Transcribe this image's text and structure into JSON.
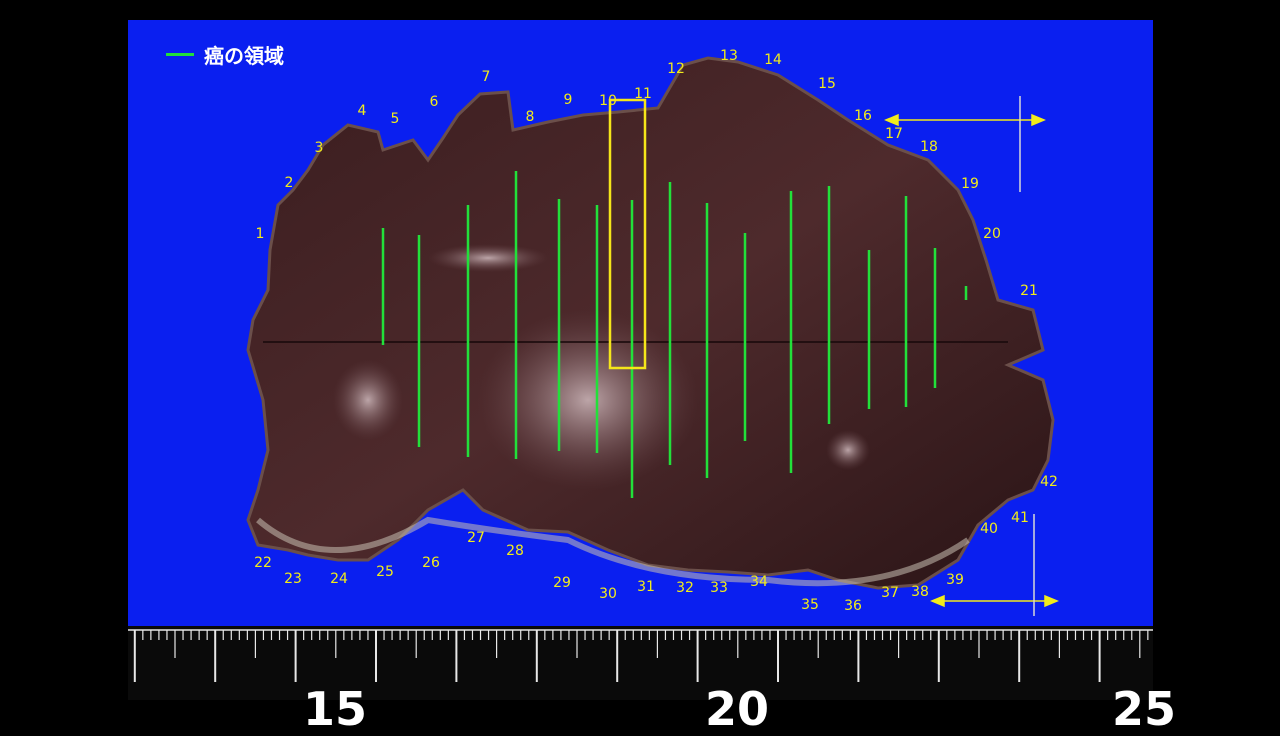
{
  "legend": {
    "label": "癌の領域",
    "color": "#22e03a"
  },
  "colors": {
    "background": "#0a1ff0",
    "tissue": "#3a1c1c",
    "section_number": "#f2ec1a",
    "selection_box": "#f5e61a",
    "tumor_line": "#22e03a"
  },
  "section_numbers": [
    "1",
    "2",
    "3",
    "4",
    "5",
    "6",
    "7",
    "8",
    "9",
    "10",
    "11",
    "12",
    "13",
    "14",
    "15",
    "16",
    "17",
    "18",
    "19",
    "20",
    "21",
    "22",
    "23",
    "24",
    "25",
    "26",
    "27",
    "28",
    "29",
    "30",
    "31",
    "32",
    "33",
    "34",
    "35",
    "36",
    "37",
    "38",
    "39",
    "40",
    "41",
    "42"
  ],
  "ruler": {
    "labels": [
      "15",
      "20",
      "25"
    ]
  }
}
